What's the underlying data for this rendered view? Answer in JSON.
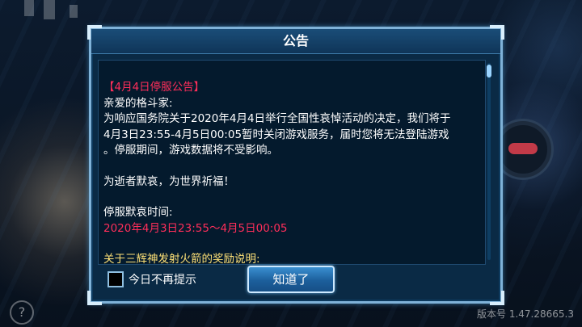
{
  "dialog": {
    "title": "公告",
    "lines": [
      "【4月4日停服公告】",
      "亲爱的格斗家:",
      "为响应国务院关于2020年4月4日举行全国性哀悼活动的决定，我们将于",
      "4月3日23:55-4月5日00:05暂时关闭游戏服务，届时您将无法登陆游戏",
      "。停服期间，游戏数据将不受影响。",
      "为逝者默哀，为世界祈福！",
      "停服默哀时间:",
      "2020年4月3日23:55～4月5日00:05",
      "关于三辉神发射火箭的奖励说明:"
    ],
    "checkbox_label": "今日不再提示",
    "checkbox_checked": false,
    "ok_button": "知道了"
  },
  "version_text": "版本号 1.47.28665.3",
  "colors": {
    "highlight_red": "#ff2e5a",
    "highlight_gold": "#ffe277",
    "dialog_border": "#7fb2d8",
    "button_blue": "#1c5f9c"
  },
  "icons": [
    "help-icon"
  ]
}
